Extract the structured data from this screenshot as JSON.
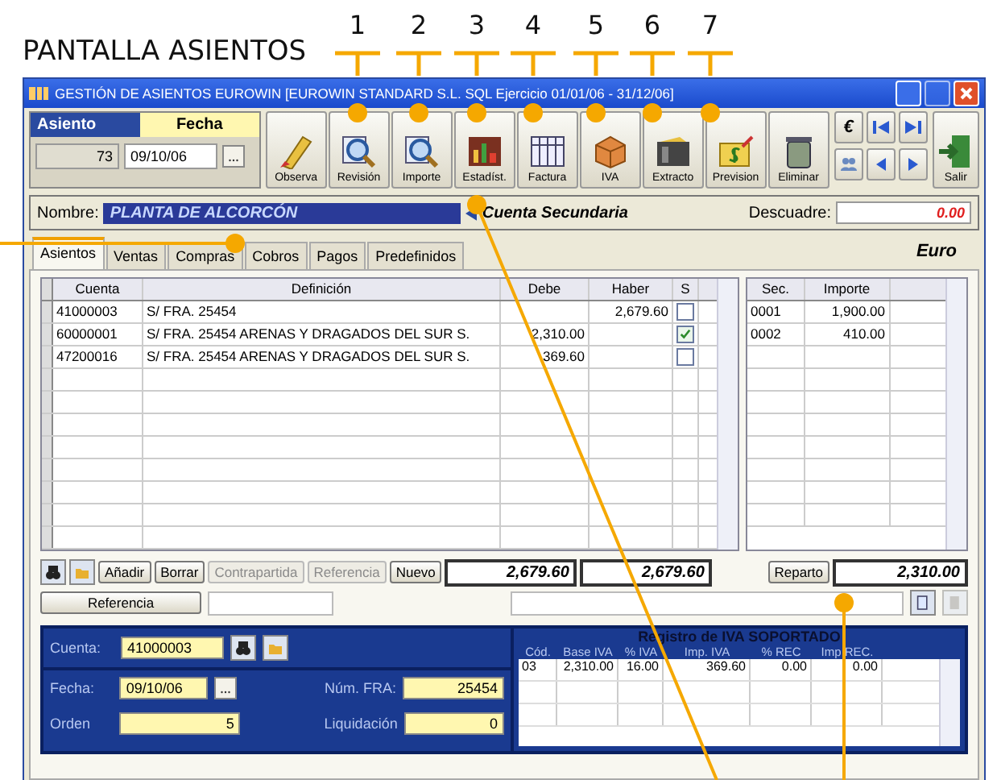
{
  "page_title": "PANTALLA ASIENTOS",
  "callouts": [
    "1",
    "2",
    "3",
    "4",
    "5",
    "6",
    "7"
  ],
  "window": {
    "title": "GESTIÓN DE ASIENTOS EUROWIN  [EUROWIN STANDARD S.L. SQL Ejercicio 01/01/06 - 31/12/06]"
  },
  "entry": {
    "asiento_label": "Asiento",
    "fecha_label": "Fecha",
    "asiento": "73",
    "fecha": "09/10/06"
  },
  "toolbar": [
    {
      "label": "Observa",
      "kind": "pencil"
    },
    {
      "label": "Revisión",
      "kind": "magnifier"
    },
    {
      "label": "Importe",
      "kind": "magnifier"
    },
    {
      "label": "Estadíst.",
      "kind": "chart"
    },
    {
      "label": "Factura",
      "kind": "table"
    },
    {
      "label": "IVA",
      "kind": "box"
    },
    {
      "label": "Extracto",
      "kind": "folder"
    },
    {
      "label": "Prevision",
      "kind": "money"
    },
    {
      "label": "Eliminar",
      "kind": "trash"
    }
  ],
  "nav": [
    {
      "kind": "euro",
      "label": "€"
    },
    {
      "kind": "first"
    },
    {
      "kind": "last"
    },
    {
      "kind": "people"
    },
    {
      "kind": "prev"
    },
    {
      "kind": "next"
    }
  ],
  "exit": {
    "label": "Salir"
  },
  "account": {
    "label": "Nombre:",
    "value": "PLANTA DE ALCORCÓN",
    "secondary": "Cuenta Secundaria",
    "mismatch_label": "Descuadre:",
    "mismatch": "0.00"
  },
  "tabs": [
    {
      "label": "Asientos",
      "selected": true
    },
    {
      "label": "Ventas",
      "selected": false
    },
    {
      "label": "Compras",
      "selected": false
    },
    {
      "label": "Cobros",
      "selected": false
    },
    {
      "label": "Pagos",
      "selected": false
    },
    {
      "label": "Predefinidos",
      "selected": false
    }
  ],
  "currency": "Euro",
  "entries": {
    "columns": [
      "Cuenta",
      "Definición",
      "Debe",
      "Haber",
      "S"
    ],
    "rows": [
      {
        "cuenta": "41000003",
        "definicion": "S/ FRA. 25454",
        "debe": "",
        "haber": "2,679.60",
        "checked": false
      },
      {
        "cuenta": "60000001",
        "definicion": "S/ FRA. 25454 ARENAS Y DRAGADOS DEL SUR S.",
        "debe": "2,310.00",
        "haber": "",
        "checked": true
      },
      {
        "cuenta": "47200016",
        "definicion": "S/ FRA. 25454 ARENAS Y DRAGADOS DEL SUR S.",
        "debe": "369.60",
        "haber": "",
        "checked": false
      }
    ]
  },
  "sections": {
    "columns": [
      "Sec.",
      "Importe"
    ],
    "rows": [
      [
        "0001",
        "1,900.00"
      ],
      [
        "0002",
        "410.00"
      ]
    ]
  },
  "actions": [
    {
      "label": "Añadir",
      "disabled": false
    },
    {
      "label": "Borrar",
      "disabled": false
    },
    {
      "label": "Contrapartida",
      "disabled": true
    },
    {
      "label": "Referencia",
      "disabled": true
    },
    {
      "label": "Nuevo",
      "disabled": false
    }
  ],
  "totals": {
    "debe": "2,679.60",
    "haber": "2,679.60",
    "split_button": "Reparto",
    "split_total": "2,310.00"
  },
  "reference": {
    "button": "Referencia"
  },
  "invoice": {
    "cuenta_label": "Cuenta:",
    "cuenta": "41000003",
    "fecha_label": "Fecha:",
    "fecha": "09/10/06",
    "orden_label": "Orden",
    "orden": "5",
    "num_label": "Núm. FRA:",
    "num": "25454",
    "liq_label": "Liquidación",
    "liq": "0"
  },
  "vat": {
    "title": "Registro de IVA SOPORTADO",
    "columns": [
      "Cód.",
      "Base IVA",
      "% IVA",
      "Imp. IVA",
      "% REC",
      "Imp REC."
    ],
    "rows": [
      [
        "03",
        "2,310.00",
        "16.00",
        "369.60",
        "0.00",
        "0.00"
      ]
    ]
  }
}
